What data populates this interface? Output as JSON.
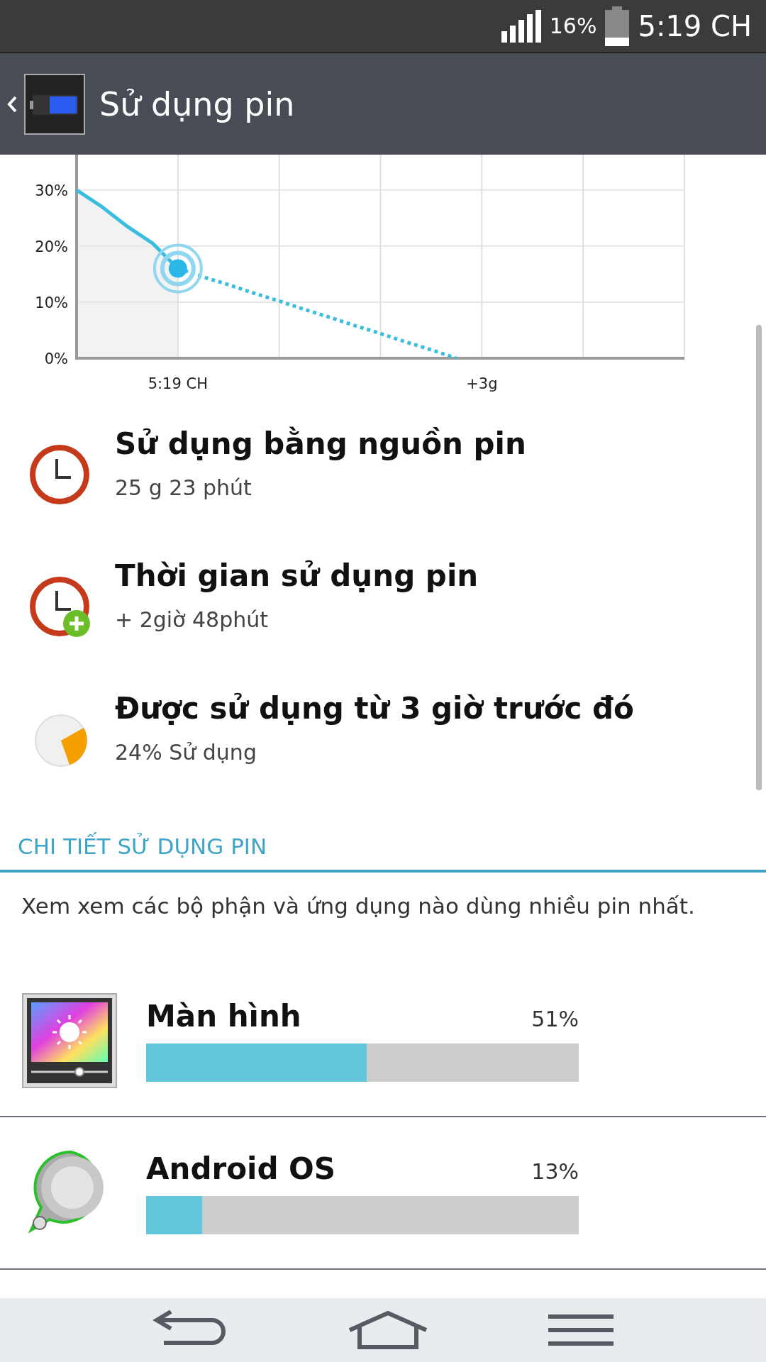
{
  "status_bar": {
    "battery": "16%",
    "time": "5:19 CH"
  },
  "app_bar": {
    "title": "Sử dụng pin"
  },
  "chart": {
    "chart_data": {
      "type": "line",
      "categories": [
        null,
        null,
        null,
        null,
        "5:19 CH",
        null,
        null,
        null,
        null,
        null,
        null,
        null,
        null,
        null,
        null,
        null,
        "+3g",
        null,
        null,
        null,
        null,
        null,
        null,
        null,
        null
      ],
      "ylim": [
        0,
        36.3
      ],
      "grid": true,
      "yticks": [
        {
          "value": 0,
          "label": "0%"
        },
        {
          "value": 10,
          "label": "10%"
        },
        {
          "value": 20,
          "label": "20%"
        },
        {
          "value": 30,
          "label": "30%"
        }
      ],
      "series": [
        {
          "color": "#3bbde0",
          "line_style": "solid",
          "values": [
            30,
            27,
            23.5,
            20.5,
            16,
            null,
            null,
            null,
            null,
            null,
            null,
            null,
            null,
            null,
            null,
            null,
            null,
            null,
            null,
            null,
            null,
            null,
            null,
            null,
            null
          ]
        },
        {
          "color": "#3bbde0",
          "line_style": "dashed",
          "values": [
            null,
            null,
            null,
            null,
            16,
            14.5,
            13.1,
            11.6,
            10.2,
            8.7,
            7.3,
            5.8,
            4.4,
            2.9,
            1.5,
            0,
            null,
            null,
            null,
            null,
            null,
            null,
            null,
            null,
            null
          ]
        }
      ]
    }
  },
  "summary": [
    {
      "kind": "clock",
      "title": "Sử dụng bằng nguồn pin",
      "value": "25 g 23 phút"
    },
    {
      "kind": "clock_plus",
      "title": "Thời gian sử dụng pin",
      "value": "+ 2giờ 48phút"
    },
    {
      "kind": "pie",
      "title": "Được sử dụng từ 3 giờ trước đó",
      "value": "24% Sử dụng"
    }
  ],
  "section": {
    "title": "CHI TIẾT SỬ DỤNG PIN",
    "description": "Xem xem các bộ phận và ứng dụng nào dùng nhiều pin nhất."
  },
  "apps": [
    {
      "kind": "screen",
      "name": "Màn hình",
      "percent": "51%",
      "level": 0.51
    },
    {
      "kind": "android",
      "name": "Android OS",
      "percent": "13%",
      "level": 0.13
    }
  ]
}
